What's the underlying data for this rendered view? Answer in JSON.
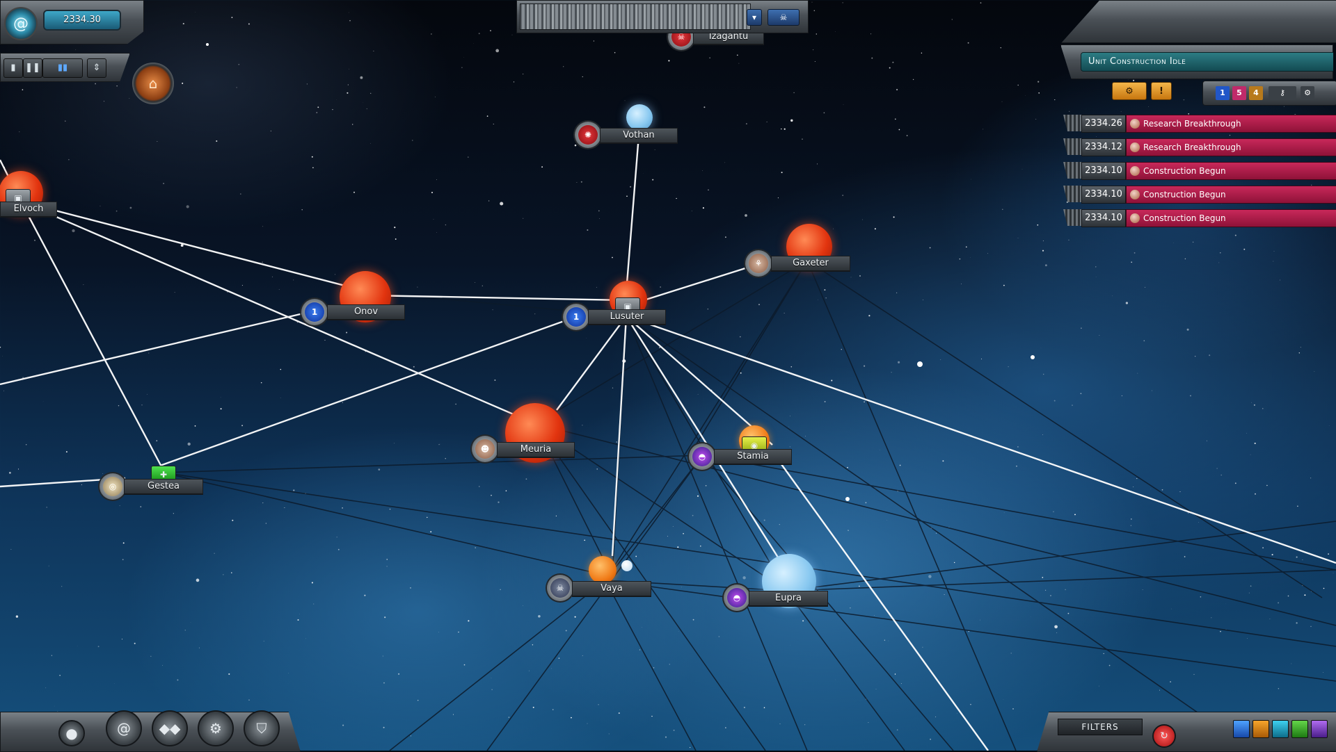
{
  "hud": {
    "date": "2334.30",
    "unit_construction": "Unit Construction Idle",
    "filters_label": "FILTERS",
    "mini_counts": [
      "1",
      "5",
      "4"
    ]
  },
  "notifications": [
    {
      "date": "2334.26",
      "message": "Research Breakthrough"
    },
    {
      "date": "2334.12",
      "message": "Research Breakthrough"
    },
    {
      "date": "2334.10",
      "message": "Construction Begun"
    },
    {
      "date": "2334.10",
      "message": "Construction Begun"
    },
    {
      "date": "2334.10",
      "message": "Construction Begun"
    }
  ],
  "systems": {
    "izagantu": "Izagantu",
    "vothan": "Vothan",
    "elvoch": "Elvoch",
    "onov": "Onov",
    "lusuter": "Lusuter",
    "gaxeter": "Gaxeter",
    "meuria": "Meuria",
    "stamia": "Stamia",
    "gestea": "Gestea",
    "vaya": "Vaya",
    "eupra": "Eupra"
  },
  "badges": {
    "onov_fleet": "1",
    "lusuter_fleet": "1"
  },
  "icons": {
    "galaxy": "galaxy-swirl-icon",
    "pause": "pause-icon",
    "speed": "speed-bars-icon",
    "alert": "alert-icon",
    "shield": "shield-icon",
    "gear": "gear-icon"
  },
  "colors": {
    "notification_bg": "#b21d4b",
    "unit_panel": "#1d6a72",
    "date_pill": "#2c86a6",
    "lane_white": "#ffffff",
    "lane_dark": "#0d1d2e"
  }
}
